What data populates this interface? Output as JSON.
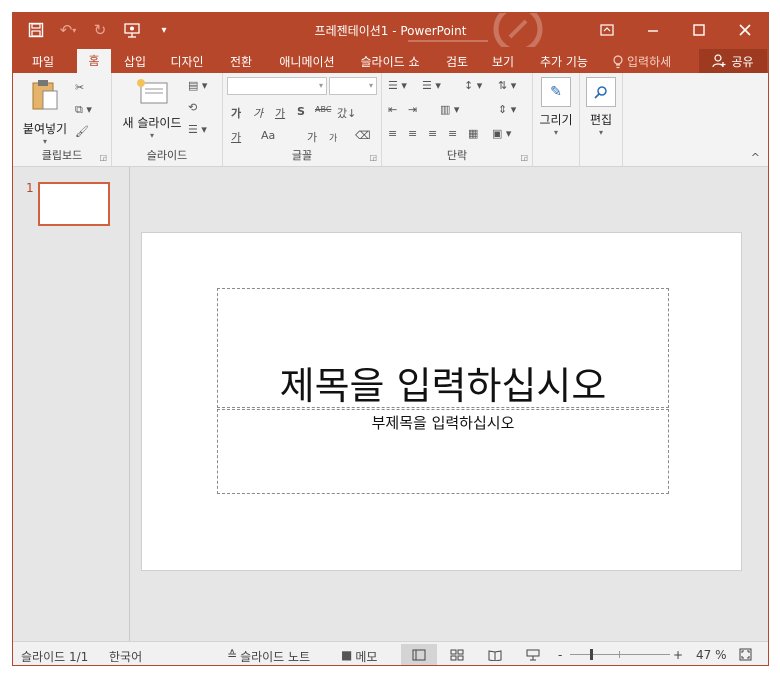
{
  "app": {
    "title": "프레젠테이션1 - PowerPoint",
    "accent": "#b7472a"
  },
  "qat": [
    {
      "icon": "save-icon"
    },
    {
      "icon": "undo-icon"
    },
    {
      "icon": "redo-icon"
    },
    {
      "icon": "start-from-beginning-icon"
    },
    {
      "icon": "customize-qat-icon"
    }
  ],
  "window_controls": [
    {
      "icon": "ribbon-display-options-icon"
    },
    {
      "icon": "minimize-icon"
    },
    {
      "icon": "maximize-icon"
    },
    {
      "icon": "close-icon"
    }
  ],
  "tabs": [
    "파일",
    "홈",
    "삽입",
    "디자인",
    "전환",
    "애니메이션",
    "슬라이드 쇼",
    "검토",
    "보기",
    "추가 기능"
  ],
  "active_tab": "홈",
  "tell_me": "입력하세",
  "share": "공유",
  "ribbon": {
    "clipboard": {
      "label": "클립보드",
      "paste": "붙여넣기"
    },
    "slides": {
      "label": "슬라이드",
      "new_slide": "새 슬라이드"
    },
    "font": {
      "label": "글꼴",
      "font_name": "",
      "font_size": "",
      "row1": [
        "가",
        "가",
        "가",
        "S",
        "ABC",
        "갔↓"
      ],
      "row2": [
        "가",
        "Aa",
        "가",
        "가"
      ]
    },
    "paragraph": {
      "label": "단락"
    },
    "drawing": {
      "label": "그리기"
    },
    "editing": {
      "label": "편집"
    }
  },
  "thumbnails": [
    {
      "number": "1"
    }
  ],
  "slide": {
    "title_placeholder": "제목을 입력하십시오",
    "subtitle_placeholder": "부제목을 입력하십시오"
  },
  "status": {
    "slide_counter": "슬라이드 1/1",
    "language": "한국어",
    "notes": "슬라이드 노트",
    "comments": "메모",
    "zoom_minus": "-",
    "zoom_plus": "+",
    "zoom_value": "47 %",
    "zoom_fraction": 0.47
  }
}
